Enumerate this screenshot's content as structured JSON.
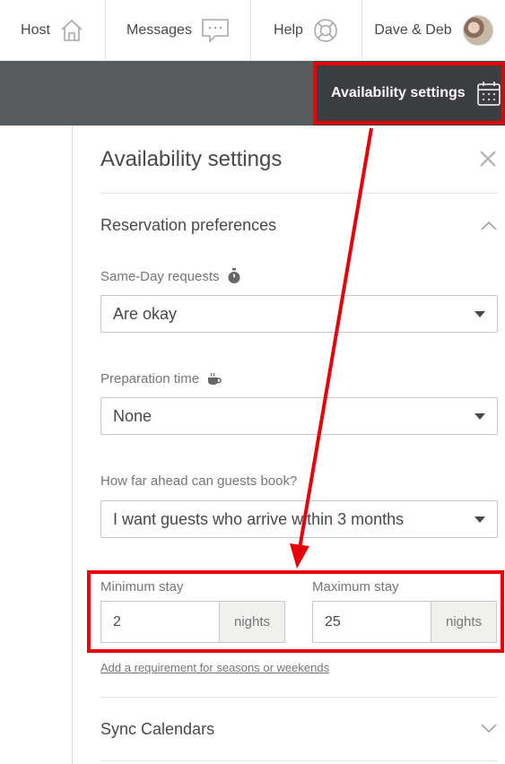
{
  "nav": {
    "host_label": "Host",
    "messages_label": "Messages",
    "help_label": "Help",
    "user_label": "Dave & Deb"
  },
  "toolbar": {
    "availability_label": "Availability settings"
  },
  "panel": {
    "title": "Availability settings",
    "reservation_section": "Reservation preferences",
    "same_day": {
      "label": "Same-Day requests",
      "value": "Are okay"
    },
    "prep_time": {
      "label": "Preparation time",
      "value": "None"
    },
    "advance": {
      "label": "How far ahead can guests book?",
      "value": "I want guests who arrive within 3 months"
    },
    "min_stay": {
      "label": "Minimum stay",
      "value": "2",
      "unit": "nights"
    },
    "max_stay": {
      "label": "Maximum stay",
      "value": "25",
      "unit": "nights"
    },
    "requirement_link": "Add a requirement for seasons or weekends",
    "sync_section": "Sync Calendars"
  },
  "colors": {
    "annotation_red": "#e5000a",
    "toolbar_bg": "#585b5e",
    "active_button_bg": "#3c3d40"
  }
}
